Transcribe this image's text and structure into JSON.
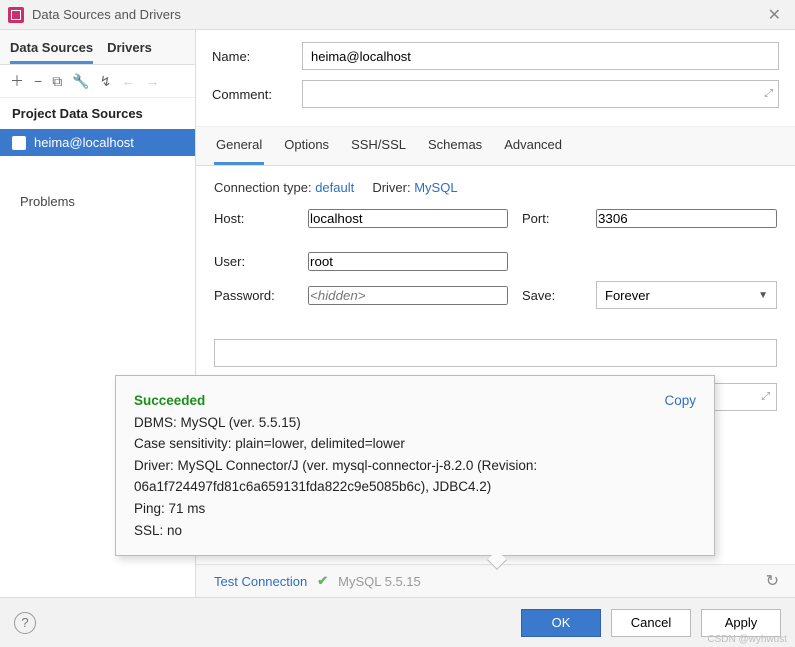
{
  "window": {
    "title": "Data Sources and Drivers"
  },
  "sidebar": {
    "tabs": [
      "Data Sources",
      "Drivers"
    ],
    "active_tab": 0,
    "section": "Project Data Sources",
    "items": [
      {
        "label": "heima@localhost",
        "selected": true
      }
    ],
    "problems_label": "Problems"
  },
  "form": {
    "name_label": "Name:",
    "name_value": "heima@localhost",
    "comment_label": "Comment:",
    "comment_value": ""
  },
  "subtabs": [
    "General",
    "Options",
    "SSH/SSL",
    "Schemas",
    "Advanced"
  ],
  "active_subtab": 0,
  "conn": {
    "type_label": "Connection type:",
    "type_value": "default",
    "driver_label": "Driver:",
    "driver_value": "MySQL"
  },
  "fields": {
    "host_label": "Host:",
    "host_value": "localhost",
    "port_label": "Port:",
    "port_value": "3306",
    "user_label": "User:",
    "user_value": "root",
    "password_label": "Password:",
    "password_placeholder": "<hidden>",
    "save_label": "Save:",
    "save_value": "Forever"
  },
  "popup": {
    "title": "Succeeded",
    "copy": "Copy",
    "lines": [
      "DBMS: MySQL (ver. 5.5.15)",
      "Case sensitivity: plain=lower, delimited=lower",
      "Driver: MySQL Connector/J (ver. mysql-connector-j-8.2.0 (Revision: 06a1f724497fd81c6a659131fda822c9e5085b6c), JDBC4.2)",
      "Ping: 71 ms",
      "SSL: no"
    ]
  },
  "test": {
    "label": "Test Connection",
    "version": "MySQL 5.5.15"
  },
  "footer": {
    "ok": "OK",
    "cancel": "Cancel",
    "apply": "Apply"
  },
  "watermark": "CSDN @wyhwust"
}
